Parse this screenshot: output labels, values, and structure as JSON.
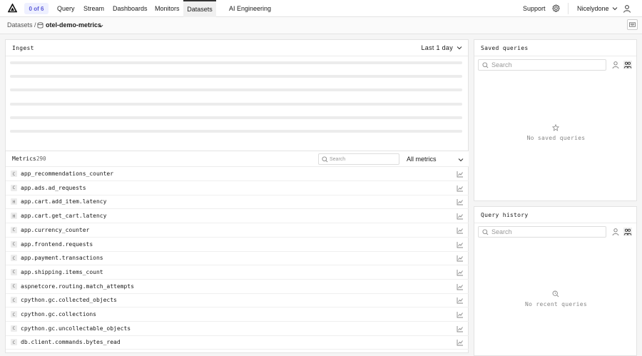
{
  "nav": {
    "badge": "0 of 6",
    "tabs": [
      {
        "label": "Query"
      },
      {
        "label": "Stream"
      },
      {
        "label": "Dashboards"
      },
      {
        "label": "Monitors"
      },
      {
        "label": "Datasets"
      },
      {
        "label": "AI Engineering"
      }
    ],
    "active_tab": "Datasets",
    "support": "Support",
    "org": "Nicelydone"
  },
  "breadcrumb": {
    "root": "Datasets /",
    "dataset": "otel-demo-metrics"
  },
  "ingest": {
    "title": "Ingest",
    "range": "Last 1 day",
    "loading_bars": 6
  },
  "metrics": {
    "title": "Metrics",
    "count": "290",
    "search_placeholder": "Search",
    "filter": "All metrics",
    "rows": [
      {
        "type": "C",
        "name": "app_recommendations_counter"
      },
      {
        "type": "C",
        "name": "app.ads.ad_requests"
      },
      {
        "type": "H",
        "name": "app.cart.add_item.latency"
      },
      {
        "type": "H",
        "name": "app.cart.get_cart.latency"
      },
      {
        "type": "C",
        "name": "app.currency_counter"
      },
      {
        "type": "C",
        "name": "app.frontend.requests"
      },
      {
        "type": "C",
        "name": "app.payment.transactions"
      },
      {
        "type": "C",
        "name": "app.shipping.items_count"
      },
      {
        "type": "C",
        "name": "aspnetcore.routing.match_attempts"
      },
      {
        "type": "C",
        "name": "cpython.gc.collected_objects"
      },
      {
        "type": "C",
        "name": "cpython.gc.collections"
      },
      {
        "type": "C",
        "name": "cpython.gc.uncollectable_objects"
      },
      {
        "type": "C",
        "name": "db.client.commands.bytes_read"
      }
    ]
  },
  "saved_queries": {
    "title": "Saved queries",
    "search_placeholder": "Search",
    "empty": "No saved queries"
  },
  "query_history": {
    "title": "Query history",
    "search_placeholder": "Search",
    "empty": "No recent queries"
  },
  "colors": {
    "accent": "#5a5ad8",
    "badge_bg": "#eef0ff",
    "border": "#e3e3e3"
  }
}
